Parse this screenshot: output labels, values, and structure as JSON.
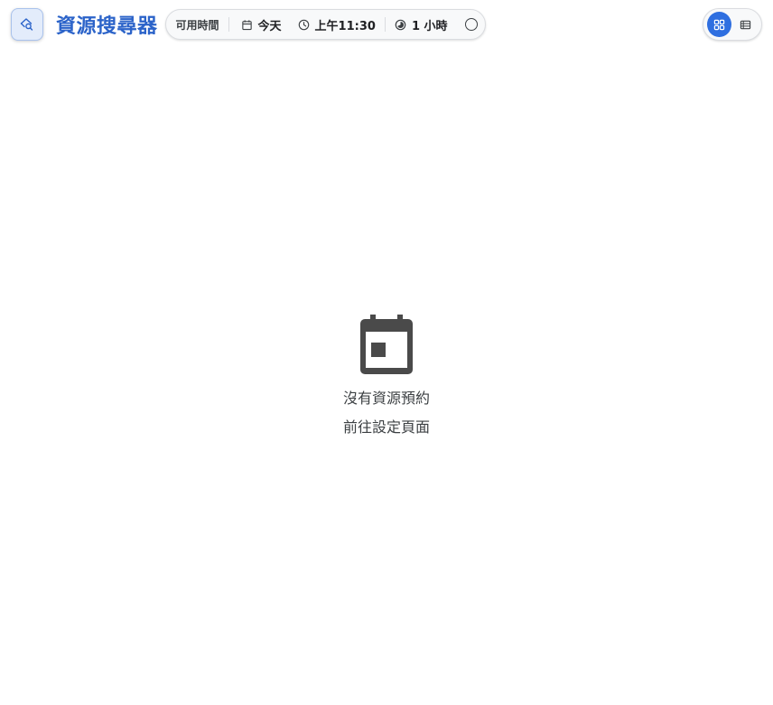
{
  "app": {
    "title": "資源搜尋器"
  },
  "filters": {
    "label": "可用時間",
    "date": "今天",
    "time": "上午11:30",
    "duration": "1 小時"
  },
  "view_toggle": {
    "options": [
      "grid",
      "list"
    ],
    "selected": "grid"
  },
  "empty_state": {
    "message": "沒有資源預約",
    "link": "前往設定頁面"
  },
  "colors": {
    "accent": "#2f6fe0",
    "title": "#2b63c9",
    "icon": "#4a4a4a"
  },
  "icons": {
    "logo": "search-resource-icon",
    "date": "calendar-icon",
    "time": "clock-icon",
    "duration": "timelapse-icon",
    "grid": "grid-view-icon",
    "list": "list-view-icon",
    "empty": "calendar-event-icon"
  }
}
